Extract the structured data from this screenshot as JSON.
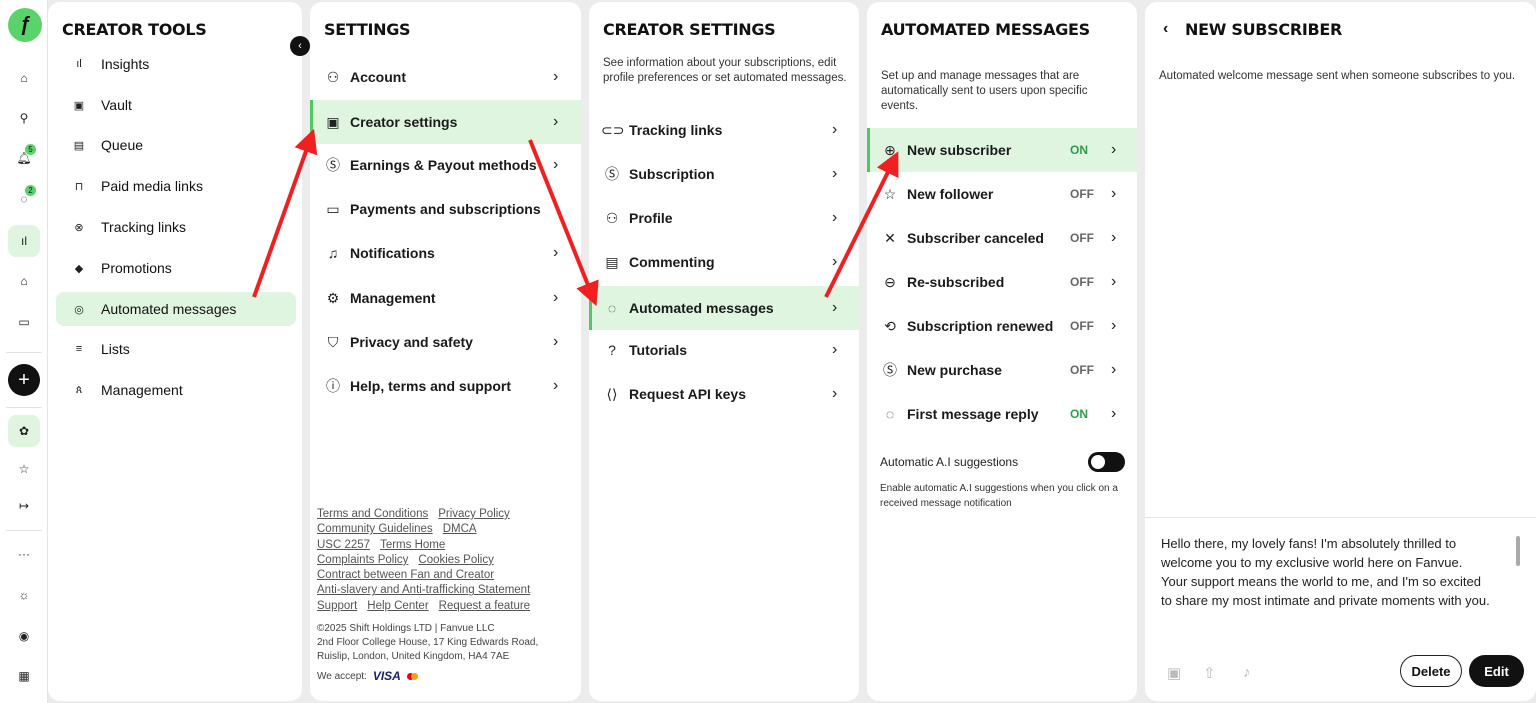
{
  "rail": {
    "notif_badge": "5",
    "msg_badge": "2",
    "icons": [
      "home-icon",
      "search-icon",
      "bell-icon",
      "chat-icon",
      "chart-icon",
      "bank-icon",
      "card-icon",
      "plus-icon",
      "flower-icon",
      "star-icon",
      "logout-icon",
      "more-icon",
      "sun-icon",
      "eye-icon",
      "flag-icon"
    ]
  },
  "creator_tools": {
    "title": "CREATOR TOOLS",
    "items": [
      {
        "label": "Insights",
        "icon": "chart-icon"
      },
      {
        "label": "Vault",
        "icon": "image-icon"
      },
      {
        "label": "Queue",
        "icon": "calendar-icon"
      },
      {
        "label": "Paid media links",
        "icon": "lock-icon"
      },
      {
        "label": "Tracking links",
        "icon": "link-icon"
      },
      {
        "label": "Promotions",
        "icon": "tag-icon"
      },
      {
        "label": "Automated messages",
        "icon": "bot-icon"
      },
      {
        "label": "Lists",
        "icon": "list-icon"
      },
      {
        "label": "Management",
        "icon": "users-icon"
      }
    ]
  },
  "settings": {
    "title": "SETTINGS",
    "items": [
      {
        "label": "Account",
        "icon": "user-icon"
      },
      {
        "label": "Creator settings",
        "icon": "money-icon"
      },
      {
        "label": "Earnings & Payout methods",
        "icon": "dollar-icon"
      },
      {
        "label": "Payments and subscriptions",
        "icon": "card-icon"
      },
      {
        "label": "Notifications",
        "icon": "bell-icon"
      },
      {
        "label": "Management",
        "icon": "gear-icon"
      },
      {
        "label": "Privacy and safety",
        "icon": "shield-icon"
      },
      {
        "label": "Help, terms and support",
        "icon": "info-icon"
      }
    ],
    "links": [
      "Terms and Conditions",
      "Privacy Policy",
      "Community Guidelines",
      "DMCA",
      "USC 2257",
      "Terms Home",
      "Complaints Policy",
      "Cookies Policy",
      "Contract between Fan and Creator",
      "Anti-slavery and Anti-trafficking Statement",
      "Support",
      "Help Center",
      "Request a feature"
    ],
    "copyright": "©2025 Shift Holdings LTD | Fanvue LLC",
    "address": "2nd Floor College House, 17 King Edwards Road, Ruislip, London, United Kingdom, HA4 7AE",
    "we_accept": "We accept:",
    "visa": "VISA"
  },
  "creator_settings": {
    "title": "CREATOR SETTINGS",
    "description": "See information about your subscriptions, edit profile preferences or set automated messages.",
    "items": [
      {
        "label": "Tracking links",
        "icon": "link-icon"
      },
      {
        "label": "Subscription",
        "icon": "dollar-icon"
      },
      {
        "label": "Profile",
        "icon": "user-icon"
      },
      {
        "label": "Commenting",
        "icon": "comment-icon"
      },
      {
        "label": "Automated messages",
        "icon": "chat-icon"
      },
      {
        "label": "Tutorials",
        "icon": "help-icon"
      },
      {
        "label": "Request API keys",
        "icon": "code-icon"
      }
    ]
  },
  "automated_messages": {
    "title": "AUTOMATED MESSAGES",
    "description": "Set up and manage messages that are automatically sent to users upon specific events.",
    "items": [
      {
        "label": "New subscriber",
        "status": "ON",
        "icon": "plus-circle-icon"
      },
      {
        "label": "New follower",
        "status": "OFF",
        "icon": "star-icon"
      },
      {
        "label": "Subscriber canceled",
        "status": "OFF",
        "icon": "x-icon"
      },
      {
        "label": "Re-subscribed",
        "status": "OFF",
        "icon": "arrow-left-circle-icon"
      },
      {
        "label": "Subscription renewed",
        "status": "OFF",
        "icon": "repeat-icon"
      },
      {
        "label": "New purchase",
        "status": "OFF",
        "icon": "dollar-icon"
      },
      {
        "label": "First message reply",
        "status": "ON",
        "icon": "chat-icon"
      }
    ],
    "ai_label": "Automatic A.I suggestions",
    "ai_desc": "Enable automatic A.I suggestions when you click on a received message notification"
  },
  "new_subscriber": {
    "title": "NEW SUBSCRIBER",
    "description": "Automated welcome message sent when someone subscribes to you.",
    "message": "Hello there, my lovely fans! I'm absolutely thrilled to welcome you to my exclusive world here on Fanvue. Your support means the world to me, and I'm so excited to share my most intimate and private moments with you.",
    "delete_label": "Delete",
    "edit_label": "Edit"
  }
}
